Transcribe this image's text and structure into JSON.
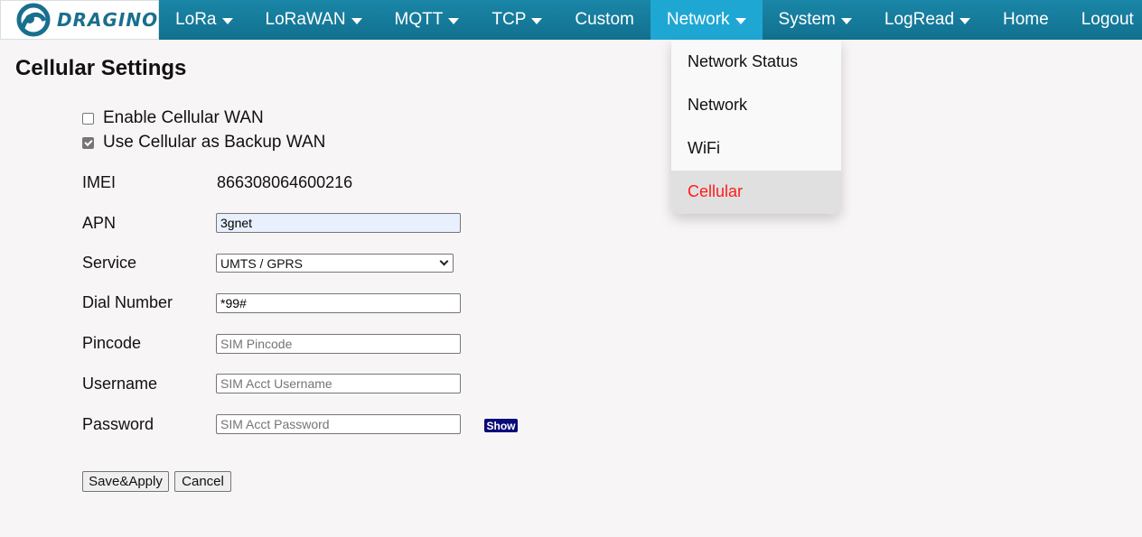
{
  "brand": {
    "logo_text": "DRAGINO",
    "nav_color": "#12708f",
    "active_color": "#1fa7d4"
  },
  "nav": [
    {
      "label": "LoRa",
      "caret": true,
      "active": false
    },
    {
      "label": "LoRaWAN",
      "caret": true,
      "active": false
    },
    {
      "label": "MQTT",
      "caret": true,
      "active": false
    },
    {
      "label": "TCP",
      "caret": true,
      "active": false
    },
    {
      "label": "Custom",
      "caret": false,
      "active": false
    },
    {
      "label": "Network",
      "caret": true,
      "active": true
    },
    {
      "label": "System",
      "caret": true,
      "active": false
    },
    {
      "label": "LogRead",
      "caret": true,
      "active": false
    },
    {
      "label": "Home",
      "caret": false,
      "active": false
    },
    {
      "label": "Logout",
      "caret": false,
      "active": false
    }
  ],
  "network_menu": {
    "items": [
      "Network Status",
      "Network",
      "WiFi",
      "Cellular"
    ],
    "selected": "Cellular",
    "selected_color": "#ff1a1a"
  },
  "page": {
    "title": "Cellular Settings",
    "enable_wan": {
      "label": "Enable Cellular WAN",
      "checked": false
    },
    "backup_wan": {
      "label": "Use Cellular as Backup WAN",
      "checked": true
    },
    "imei": {
      "label": "IMEI",
      "value": "866308064600216"
    },
    "apn": {
      "label": "APN",
      "value": "3gnet"
    },
    "service": {
      "label": "Service",
      "value": "UMTS / GPRS"
    },
    "dial": {
      "label": "Dial Number",
      "value": "*99#"
    },
    "pincode": {
      "label": "Pincode",
      "placeholder": "SIM Pincode"
    },
    "username": {
      "label": "Username",
      "placeholder": "SIM Acct Username"
    },
    "password": {
      "label": "Password",
      "placeholder": "SIM Acct Password",
      "show_label": "Show"
    },
    "save_label": "Save&Apply",
    "cancel_label": "Cancel"
  }
}
